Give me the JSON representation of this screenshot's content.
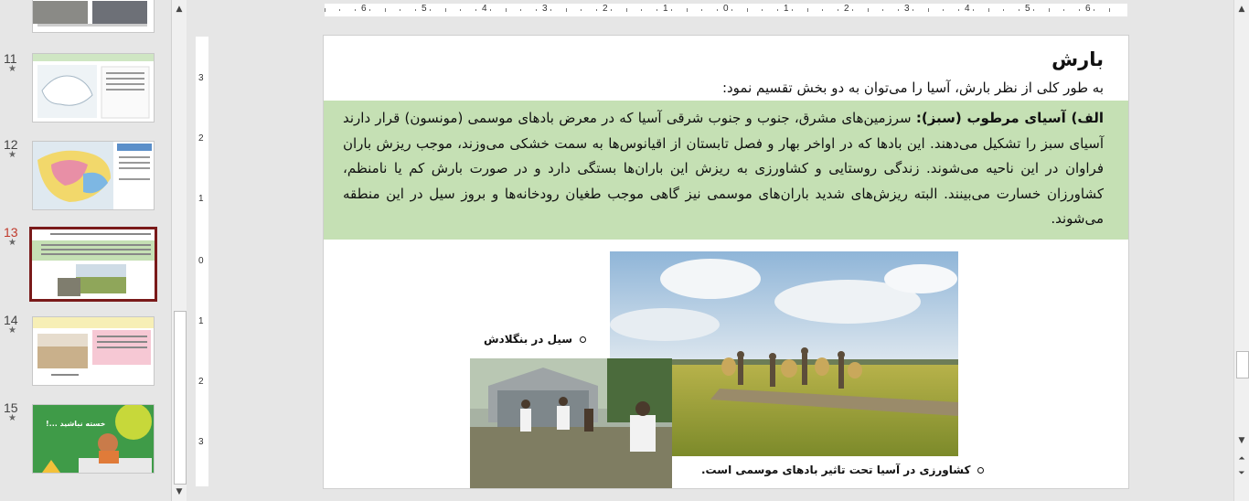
{
  "thumbnails": [
    {
      "number": "11",
      "star": "★"
    },
    {
      "number": "12",
      "star": "★"
    },
    {
      "number": "13",
      "star": "★"
    },
    {
      "number": "14",
      "star": "★"
    },
    {
      "number": "15",
      "star": "★"
    }
  ],
  "thumb15_text": "خسته نباشید ...!",
  "ruler": {
    "h_labels": [
      "6",
      "5",
      "4",
      "3",
      "2",
      "1",
      "0",
      "1",
      "2",
      "3",
      "4",
      "5",
      "6"
    ],
    "v_labels": [
      "3",
      "2",
      "1",
      "0",
      "1",
      "2",
      "3"
    ]
  },
  "slide": {
    "title": "بارش",
    "intro": "به طور کلی از نظر بارش، آسیا را می‌توان به دو بخش تقسیم نمود:",
    "green_heading": "الف) آسیای مرطوب (سبز):",
    "green_body": " سرزمین‌های مشرق، جنوب و جنوب شرقی آسیا که در معرض بادهای موسمی (مونسون) قرار دارند آسیای سبز را تشکیل می‌دهند. این بادها که در اواخر بهار و فصل تابستان از اقیانوس‌ها به سمت خشکی می‌وزند، موجب ریزش باران فراوان در این ناحیه می‌شوند. زندگی روستایی و کشاورزی به ریزش این باران‌ها بستگی دارد و در صورت بارش کم یا نامنظم، کشاورزان خسارت می‌بینند. البته ریزش‌های شدید باران‌های موسمی نیز گاهی موجب طغیان رودخانه‌ها و بروز سیل در این منطقه می‌شوند.",
    "caption_flood": "سیل در بنگلادش",
    "caption_farm": "کشاورزی در آسیا تحت تاثیر بادهای موسمی است."
  },
  "colors": {
    "green_box": "#c5e0b4",
    "active_thumb_border": "#7a1a1a"
  }
}
